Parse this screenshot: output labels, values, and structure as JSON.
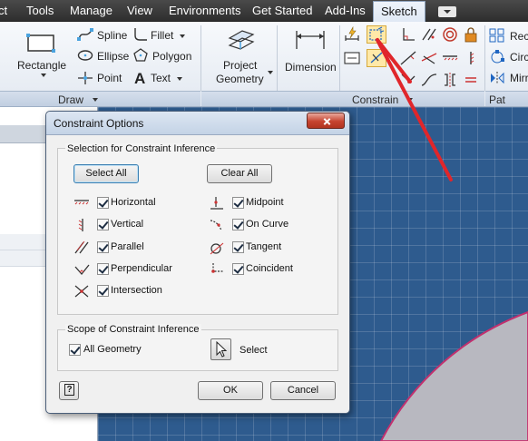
{
  "menubar": {
    "items": [
      "ct",
      "Tools",
      "Manage",
      "View",
      "Environments",
      "Get Started",
      "Add-Ins"
    ],
    "active_tab": "Sketch"
  },
  "ribbon": {
    "draw": {
      "rectangle": "Rectangle",
      "spline": "Spline",
      "ellipse": "Ellipse",
      "point": "Point",
      "fillet": "Fillet",
      "polygon": "Polygon",
      "text": "Text",
      "project_geometry": [
        "Project",
        "Geometry"
      ],
      "panel_title": "Draw"
    },
    "dimension": "Dimension",
    "constrain": {
      "panel_title": "Constrain"
    },
    "pattern": {
      "items": [
        "Rect",
        "Circ",
        "Mirr"
      ],
      "panel_title": "Pat"
    }
  },
  "dialog": {
    "title": "Constraint Options",
    "selection_group": {
      "label": "Selection for Constraint Inference",
      "select_all": "Select All",
      "clear_all": "Clear All",
      "left_options": [
        {
          "label": "Horizontal",
          "icon": "horizontal-constraint-icon",
          "checked": true
        },
        {
          "label": "Vertical",
          "icon": "vertical-constraint-icon",
          "checked": true
        },
        {
          "label": "Parallel",
          "icon": "parallel-constraint-icon",
          "checked": true
        },
        {
          "label": "Perpendicular",
          "icon": "perpendicular-constraint-icon",
          "checked": true
        },
        {
          "label": "Intersection",
          "icon": "intersection-constraint-icon",
          "checked": true
        }
      ],
      "right_options": [
        {
          "label": "Midpoint",
          "icon": "midpoint-constraint-icon",
          "checked": true
        },
        {
          "label": "On Curve",
          "icon": "on-curve-constraint-icon",
          "checked": true
        },
        {
          "label": "Tangent",
          "icon": "tangent-constraint-icon",
          "checked": true
        },
        {
          "label": "Coincident",
          "icon": "coincident-constraint-icon",
          "checked": true
        }
      ]
    },
    "scope_group": {
      "label": "Scope of Constraint Inference",
      "all_geometry": "All Geometry",
      "select": "Select"
    },
    "ok": "OK",
    "cancel": "Cancel"
  },
  "colors": {
    "canvas": "#2e5b8e",
    "annotation_arrow": "#e0262b",
    "sketch_arc": "#b8b8c0",
    "arc_outline": "#c2306e"
  }
}
